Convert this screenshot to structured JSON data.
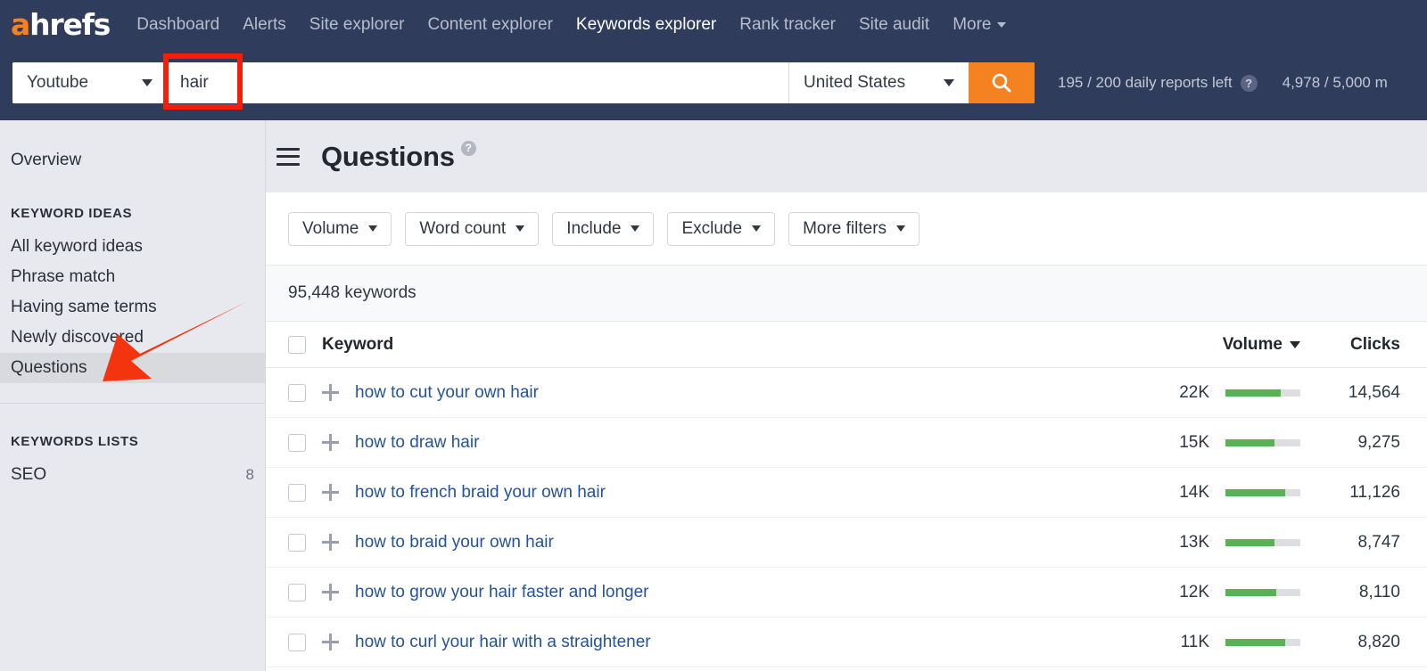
{
  "brand": {
    "logo_a": "a",
    "logo_rest": "hrefs",
    "accent_orange": "#f58220",
    "nav_bg": "#303c5c",
    "link_blue": "#24539b",
    "bar_green": "#57b257",
    "annotation_red": "#f41f09"
  },
  "nav": {
    "items": [
      {
        "label": "Dashboard",
        "active": false
      },
      {
        "label": "Alerts",
        "active": false
      },
      {
        "label": "Site explorer",
        "active": false
      },
      {
        "label": "Content explorer",
        "active": false
      },
      {
        "label": "Keywords explorer",
        "active": true
      },
      {
        "label": "Rank tracker",
        "active": false
      },
      {
        "label": "Site audit",
        "active": false
      },
      {
        "label": "More",
        "active": false,
        "has_caret": true
      }
    ]
  },
  "search": {
    "engine": "Youtube",
    "query_value": "hair",
    "query_placeholder": "",
    "country": "United States",
    "search_icon": "search-icon",
    "daily_reports": "195 / 200 daily reports left",
    "help_badge": "?",
    "monthly_rows": "4,978 / 5,000 m"
  },
  "sidebar": {
    "overview": "Overview",
    "keyword_ideas_heading": "KEYWORD IDEAS",
    "keyword_ideas": [
      {
        "label": "All keyword ideas",
        "selected": false
      },
      {
        "label": "Phrase match",
        "selected": false
      },
      {
        "label": "Having same terms",
        "selected": false
      },
      {
        "label": "Newly discovered",
        "selected": false
      },
      {
        "label": "Questions",
        "selected": true
      }
    ],
    "keywords_lists_heading": "KEYWORDS LISTS",
    "keywords_lists": [
      {
        "label": "SEO",
        "count": "8"
      }
    ]
  },
  "page": {
    "menu_icon": "hamburger-icon",
    "title": "Questions",
    "title_help": "?"
  },
  "filters": [
    {
      "label": "Volume"
    },
    {
      "label": "Word count"
    },
    {
      "label": "Include"
    },
    {
      "label": "Exclude"
    },
    {
      "label": "More filters"
    }
  ],
  "results": {
    "count_text": "95,448 keywords",
    "columns": {
      "keyword": "Keyword",
      "volume": "Volume",
      "clicks": "Clicks"
    },
    "sort_column": "Volume",
    "sort_direction": "desc",
    "rows": [
      {
        "keyword": "how to cut your own hair",
        "volume": "22K",
        "bar_pct": 74,
        "clicks": "14,564"
      },
      {
        "keyword": "how to draw hair",
        "volume": "15K",
        "bar_pct": 66,
        "clicks": "9,275"
      },
      {
        "keyword": "how to french braid your own hair",
        "volume": "14K",
        "bar_pct": 80,
        "clicks": "11,126"
      },
      {
        "keyword": "how to braid your own hair",
        "volume": "13K",
        "bar_pct": 66,
        "clicks": "8,747"
      },
      {
        "keyword": "how to grow your hair faster and longer",
        "volume": "12K",
        "bar_pct": 68,
        "clicks": "8,110"
      },
      {
        "keyword": "how to curl your hair with a straightener",
        "volume": "11K",
        "bar_pct": 80,
        "clicks": "8,820"
      }
    ]
  },
  "annotations": {
    "highlight_box_target": "search-query-input",
    "arrow_target": "sidebar-item-questions"
  }
}
